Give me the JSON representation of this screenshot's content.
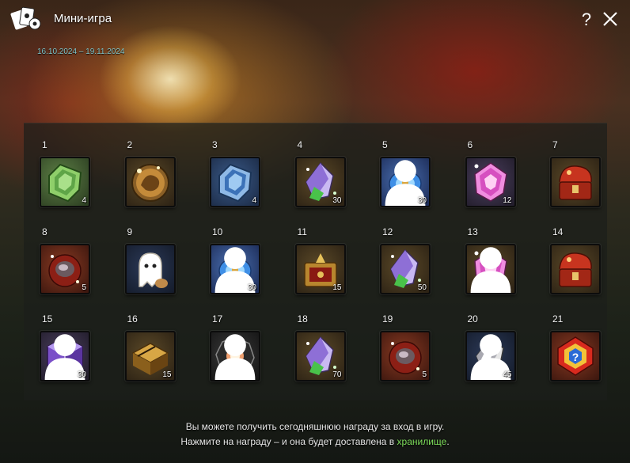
{
  "header": {
    "title": "Мини-игра",
    "help_label": "?",
    "dates": "16.10.2024 – 19.11.2024"
  },
  "rewards": [
    {
      "day": "1",
      "qty": "4",
      "icon": "green-tablet-icon",
      "bg": "bg-green",
      "personal": false
    },
    {
      "day": "2",
      "qty": "",
      "icon": "dragon-coin-icon",
      "bg": "bg-gold",
      "personal": false
    },
    {
      "day": "3",
      "qty": "4",
      "icon": "blue-tablet-icon",
      "bg": "bg-blue",
      "personal": false
    },
    {
      "day": "4",
      "qty": "30",
      "icon": "crystal-shard-icon",
      "bg": "bg-gold",
      "personal": false
    },
    {
      "day": "5",
      "qty": "30",
      "icon": "blue-lantern-icon",
      "bg": "bg-blue2",
      "personal": true
    },
    {
      "day": "6",
      "qty": "12",
      "icon": "pink-crystal-icon",
      "bg": "bg-purple",
      "personal": false
    },
    {
      "day": "7",
      "qty": "",
      "icon": "dragon-chest-icon",
      "bg": "bg-gold",
      "personal": false
    },
    {
      "day": "8",
      "qty": "5",
      "icon": "red-gem-pouch-icon",
      "bg": "bg-red",
      "personal": false
    },
    {
      "day": "9",
      "qty": "",
      "icon": "ghost-cookie-icon",
      "bg": "bg-navy",
      "personal": false
    },
    {
      "day": "10",
      "qty": "30",
      "icon": "blue-lantern-icon",
      "bg": "bg-blue2",
      "personal": true
    },
    {
      "day": "11",
      "qty": "15",
      "icon": "gold-red-chest-icon",
      "bg": "bg-gold",
      "personal": false
    },
    {
      "day": "12",
      "qty": "50",
      "icon": "crystal-shard-icon",
      "bg": "bg-gold",
      "personal": false
    },
    {
      "day": "13",
      "qty": "",
      "icon": "pink-crystal-icon",
      "bg": "bg-gold",
      "personal": true
    },
    {
      "day": "14",
      "qty": "",
      "icon": "dragon-chest-icon",
      "bg": "bg-gold",
      "personal": false
    },
    {
      "day": "15",
      "qty": "30",
      "icon": "purple-cube-icon",
      "bg": "bg-purple",
      "personal": true
    },
    {
      "day": "16",
      "qty": "15",
      "icon": "gold-chest-icon",
      "bg": "bg-gold",
      "personal": false
    },
    {
      "day": "17",
      "qty": "",
      "icon": "glowing-stone-icon",
      "bg": "bg-dark",
      "personal": true
    },
    {
      "day": "18",
      "qty": "70",
      "icon": "crystal-shard-icon",
      "bg": "bg-gold",
      "personal": false
    },
    {
      "day": "19",
      "qty": "5",
      "icon": "red-gem-pouch-icon",
      "bg": "bg-red",
      "personal": false
    },
    {
      "day": "20",
      "qty": "45",
      "icon": "silver-crystal-icon",
      "bg": "bg-navy",
      "personal": true
    },
    {
      "day": "21",
      "qty": "",
      "icon": "mystery-box-icon",
      "bg": "bg-red",
      "personal": false
    }
  ],
  "footer": {
    "line1": "Вы можете получить сегодняшнюю награду за вход в игру.",
    "line2_prefix": "Нажмите на награду – и она будет доставлена в ",
    "line2_link": "хранилище",
    "line2_suffix": "."
  },
  "colors": {
    "accent_link": "#7ddc5a",
    "dates_text": "#7fc4c9"
  }
}
